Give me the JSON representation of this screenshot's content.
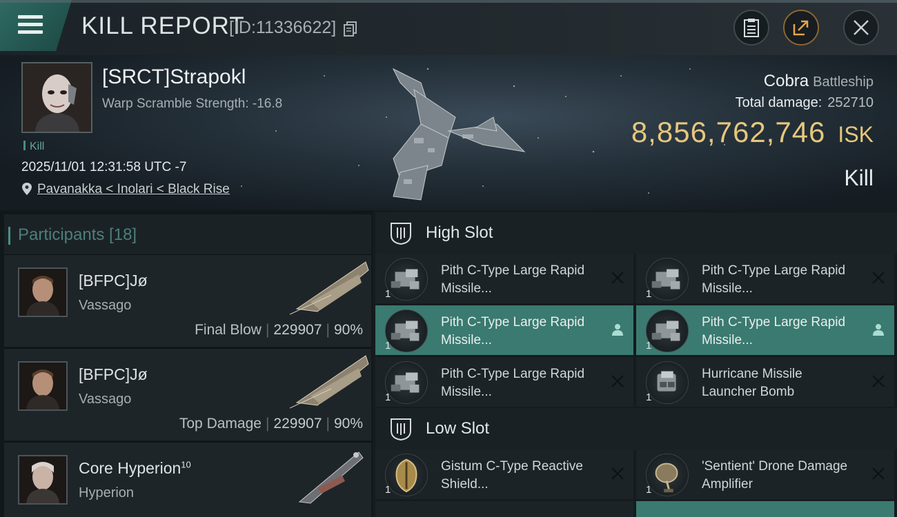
{
  "header": {
    "title": "KILL REPORT",
    "report_id": "[ID:11336622]"
  },
  "victim": {
    "name": "[SRCT]Strapokl",
    "warp_scramble": "Warp Scramble Strength: -16.8",
    "kill_tag": "Kill",
    "datetime": "2025/11/01 12:31:58 UTC -7",
    "location": "Pavanakka < Inolari < Black Rise",
    "ship_name": "Cobra",
    "ship_class": "Battleship",
    "total_damage_label": "Total damage:",
    "total_damage": "252710",
    "isk_value": "8,856,762,746",
    "isk_unit": "ISK",
    "result": "Kill"
  },
  "participants": {
    "header": "Participants [18]",
    "rows": [
      {
        "name": "[BFPC]Jø",
        "sup": "",
        "ship": "Vassago",
        "role": "Final Blow",
        "damage": "229907",
        "percent": "90%"
      },
      {
        "name": "[BFPC]Jø",
        "sup": "",
        "ship": "Vassago",
        "role": "Top Damage",
        "damage": "229907",
        "percent": "90%"
      },
      {
        "name": "Core Hyperion",
        "sup": "10",
        "ship": "Hyperion",
        "role": "",
        "damage": "",
        "percent": ""
      }
    ]
  },
  "slots": {
    "high": {
      "label": "High Slot",
      "items": [
        {
          "qty": "1",
          "name": "Pith C-Type Large Rapid Missile...",
          "status": "destroyed"
        },
        {
          "qty": "1",
          "name": "Pith C-Type Large Rapid Missile...",
          "status": "destroyed"
        },
        {
          "qty": "1",
          "name": "Pith C-Type Large Rapid Missile...",
          "status": "dropped"
        },
        {
          "qty": "1",
          "name": "Pith C-Type Large Rapid Missile...",
          "status": "dropped"
        },
        {
          "qty": "1",
          "name": "Pith C-Type Large Rapid Missile...",
          "status": "destroyed"
        },
        {
          "qty": "1",
          "name": "Hurricane Missile Launcher Bomb",
          "status": "destroyed"
        }
      ]
    },
    "low": {
      "label": "Low Slot",
      "items": [
        {
          "qty": "1",
          "name": "Gistum C-Type Reactive Shield...",
          "status": "destroyed"
        },
        {
          "qty": "1",
          "name": "'Sentient' Drone Damage Amplifier",
          "status": "destroyed"
        }
      ]
    }
  },
  "colors": {
    "accent_teal": "#3a7a70",
    "isk_gold": "#e6c77e",
    "panel_dark": "#1c2327"
  },
  "icons": [
    "menu-icon",
    "copy-icon",
    "clipboard-icon",
    "share-icon",
    "close-icon",
    "location-pin-icon",
    "slot-icon",
    "destroyed-x-icon",
    "dropped-person-icon"
  ]
}
